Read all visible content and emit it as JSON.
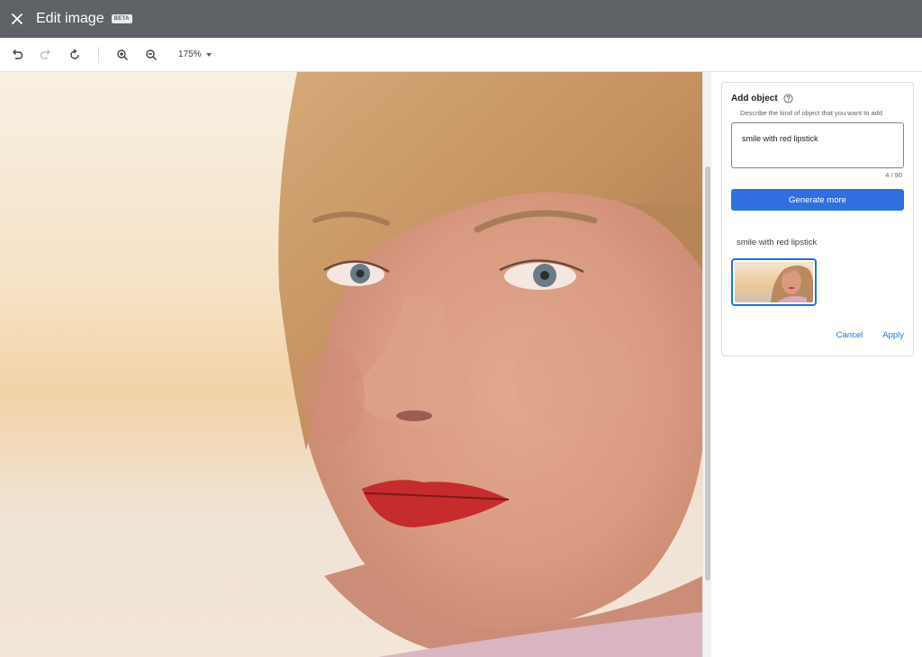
{
  "titlebar": {
    "title": "Edit image",
    "badge": "BETA",
    "close_icon": "close-icon",
    "background": "#5f6368"
  },
  "toolbar": {
    "buttons": [
      "undo-icon",
      "redo-icon",
      "rotate-icon",
      "zoom-in-icon",
      "zoom-out-icon"
    ],
    "zoom_level": "175%"
  },
  "panel": {
    "title": "Add object",
    "help_icon": "help-circle-icon",
    "field_label": "Describe the kind of object that you want to add",
    "field_value": "smile with red lipstick",
    "counter": "4 / 90",
    "generate_label": "Generate more",
    "result_label": "smile with red lipstick",
    "cancel_label": "Cancel",
    "apply_label": "Apply",
    "accent": "#2f6fe0",
    "link_color": "#1a73e8"
  }
}
